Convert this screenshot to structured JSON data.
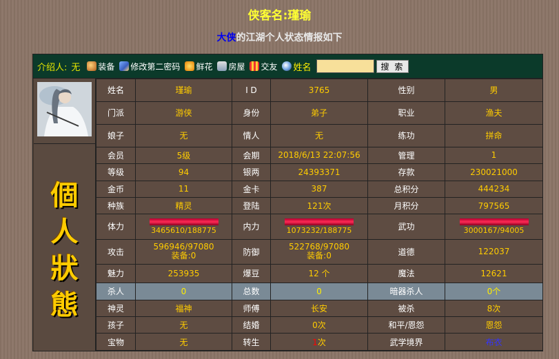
{
  "header": {
    "title": "侠客名:瑾瑜",
    "subtitle_hero": "大侠",
    "subtitle_rest": "的江湖个人状态情报如下"
  },
  "toolbar": {
    "intro_label": "介绍人:",
    "intro_value": "无",
    "links": [
      {
        "label": "装备",
        "icon": "equipment-icon"
      },
      {
        "label": "修改第二密码",
        "icon": "users-icon"
      },
      {
        "label": "鲜花",
        "icon": "flower-icon"
      },
      {
        "label": "房屋",
        "icon": "house-icon"
      },
      {
        "label": "交友",
        "icon": "gift-icon"
      }
    ],
    "name_search_label": "姓名",
    "search_value": "",
    "search_button": "搜 索"
  },
  "side_title": "個人狀態",
  "rows": [
    {
      "c": [
        [
          "姓名",
          "瑾瑜"
        ],
        [
          "I D",
          "3765"
        ],
        [
          "性别",
          "男"
        ]
      ]
    },
    {
      "c": [
        [
          "门派",
          "游侠"
        ],
        [
          "身份",
          "弟子"
        ],
        [
          "职业",
          "渔夫"
        ]
      ]
    },
    {
      "c": [
        [
          "娘子",
          "无"
        ],
        [
          "情人",
          "无"
        ],
        [
          "练功",
          "拼命"
        ]
      ]
    },
    {
      "c": [
        [
          "会员",
          "5级"
        ],
        [
          "会期",
          "2018/6/13 22:07:56"
        ],
        [
          "管理",
          "1"
        ]
      ]
    },
    {
      "c": [
        [
          "等级",
          "94"
        ],
        [
          "银两",
          "24393371"
        ],
        [
          "存款",
          "230021000"
        ]
      ]
    },
    {
      "c": [
        [
          "金币",
          "11"
        ],
        [
          "金卡",
          "387"
        ],
        [
          "总积分",
          "444234"
        ]
      ]
    },
    {
      "c": [
        [
          "种族",
          "精灵"
        ],
        [
          "登陆",
          "121次"
        ],
        [
          "月积分",
          "797565"
        ]
      ]
    },
    {
      "c": [
        [
          "体力",
          "3465610/188775"
        ],
        [
          "内力",
          "1073232/188775"
        ],
        [
          "武功",
          "3000167/94005"
        ]
      ]
    },
    {
      "c": [
        [
          "攻击",
          "596946/97080",
          "装备:0"
        ],
        [
          "防御",
          "522768/97080",
          "装备:0"
        ],
        [
          "道德",
          "122037"
        ]
      ]
    },
    {
      "c": [
        [
          "魅力",
          "253935"
        ],
        [
          "爆豆",
          "12 个"
        ],
        [
          "魔法",
          "12621"
        ]
      ]
    },
    {
      "c": [
        [
          "杀人",
          "0"
        ],
        [
          "总数",
          "0"
        ],
        [
          "暗器杀人",
          "0个"
        ]
      ]
    },
    {
      "c": [
        [
          "神灵",
          "福神"
        ],
        [
          "师傅",
          "长安"
        ],
        [
          "被杀",
          "8次"
        ]
      ]
    },
    {
      "c": [
        [
          "孩子",
          "无"
        ],
        [
          "结婚",
          "0次"
        ],
        [
          "和平/恩怨",
          "恩怨"
        ]
      ]
    },
    {
      "c": [
        [
          "宝物",
          "无"
        ],
        [
          "转生",
          "1次"
        ],
        [
          "武学境界",
          "布衣"
        ]
      ]
    }
  ],
  "bars": {
    "hp_fill": 1.0,
    "mp_fill": 1.0,
    "skill_fill": 1.0
  },
  "colors": {
    "value": "#ffcc00",
    "label": "#ffffff",
    "toolbar_bg": "#0b3a2a",
    "bar": "#ff2a55"
  }
}
